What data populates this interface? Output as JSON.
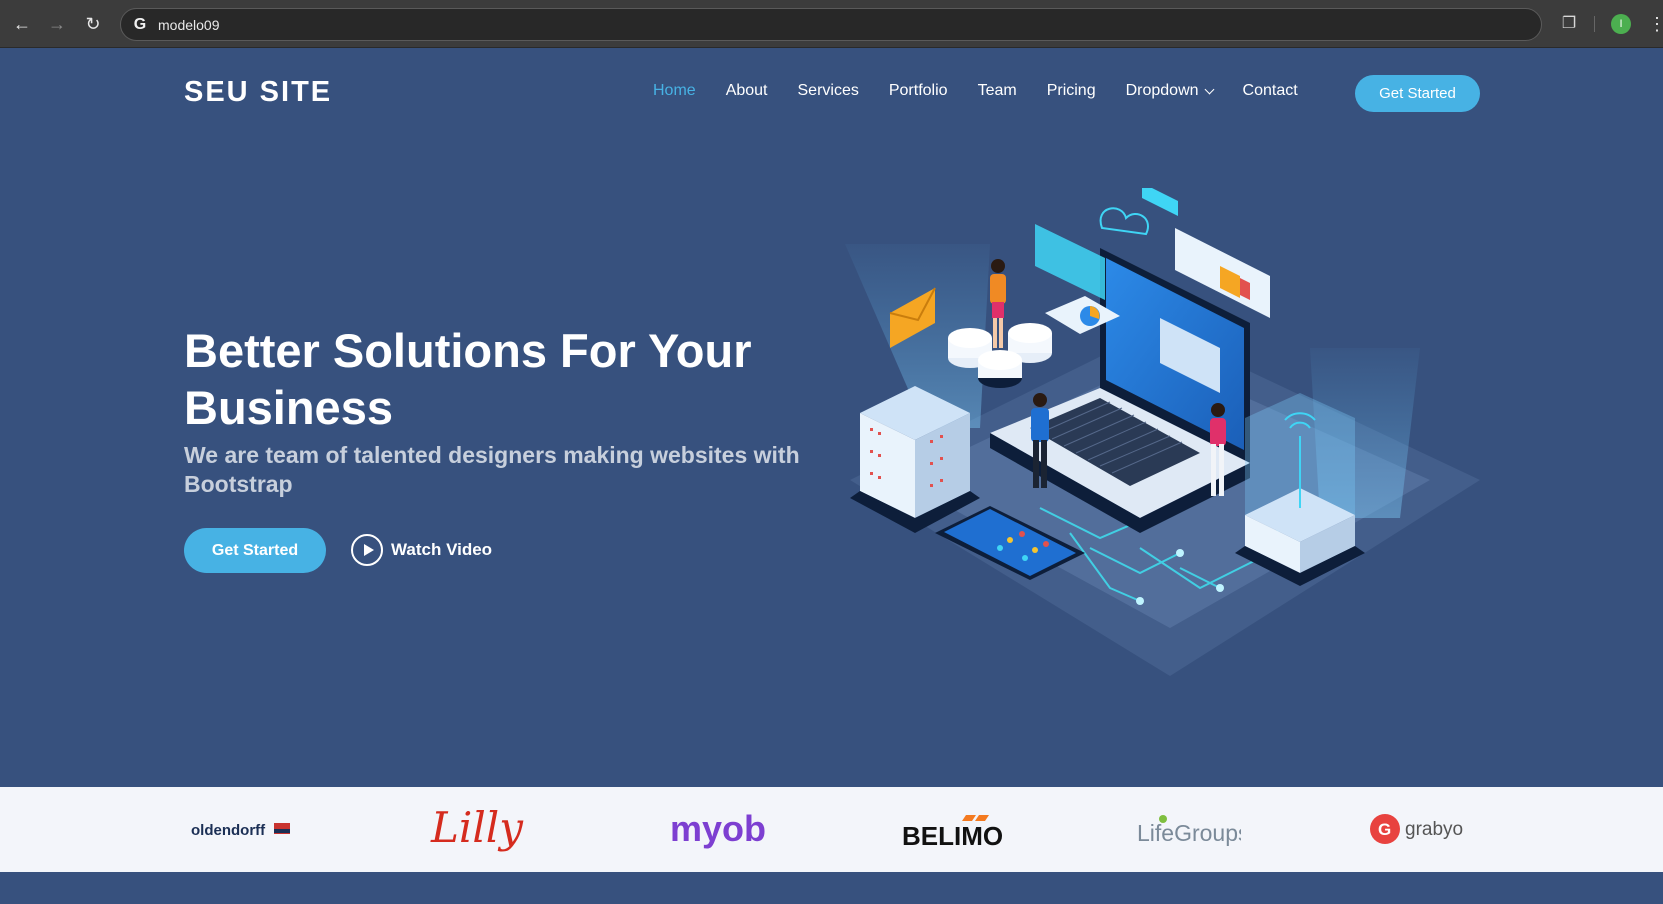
{
  "browser": {
    "url": "modelo09",
    "profile_initial": "I"
  },
  "site": {
    "logo": "SEU SITE",
    "nav": [
      {
        "label": "Home",
        "active": true
      },
      {
        "label": "About"
      },
      {
        "label": "Services"
      },
      {
        "label": "Portfolio"
      },
      {
        "label": "Team"
      },
      {
        "label": "Pricing"
      },
      {
        "label": "Dropdown"
      },
      {
        "label": "Contact"
      }
    ],
    "cta_label": "Get Started"
  },
  "hero": {
    "title": "Better Solutions For Your Business",
    "subtitle": "We are team of talented designers making websites with Bootstrap",
    "primary_button": "Get Started",
    "video_button": "Watch Video"
  },
  "clients": [
    "oldendorff",
    "Lilly",
    "myob",
    "BELIMO",
    "LifeGroups",
    "grabyo"
  ],
  "colors": {
    "background": "#37517e",
    "accent": "#47b2e4",
    "clients_strip": "#f3f5fa"
  }
}
